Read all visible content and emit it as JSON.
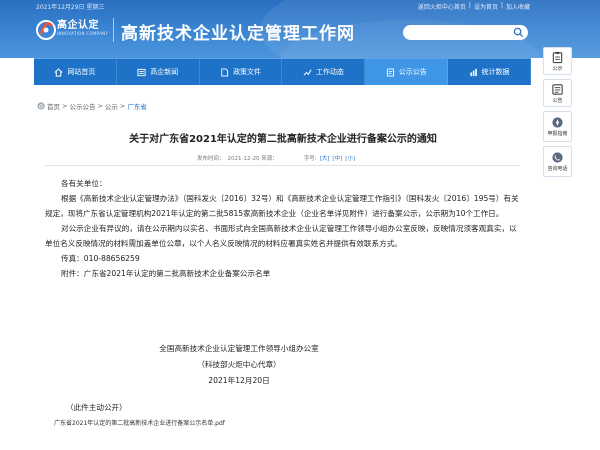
{
  "header": {
    "date": "2021年12月29日 星期三",
    "top_links": [
      "返回火炬中心首页",
      "|",
      "设为首页",
      "|",
      "加入收藏"
    ],
    "logo_text": "高企认定",
    "logo_sub": "INNOVATION COMPANY",
    "site_title": "高新技术企业认定管理工作网",
    "search_placeholder": ""
  },
  "nav": [
    {
      "label": "网站首页",
      "icon": "home-icon"
    },
    {
      "label": "高企新闻",
      "icon": "news-icon"
    },
    {
      "label": "政策文件",
      "icon": "document-icon"
    },
    {
      "label": "工作动态",
      "icon": "trend-icon"
    },
    {
      "label": "公示公告",
      "icon": "notice-icon",
      "active": true
    },
    {
      "label": "统计数据",
      "icon": "stats-icon"
    }
  ],
  "side": [
    {
      "label": "公示",
      "icon": "clipboard-icon"
    },
    {
      "label": "公告",
      "icon": "announcement-icon"
    },
    {
      "label": "申报指南",
      "icon": "guide-icon"
    },
    {
      "label": "咨询电话",
      "icon": "phone-icon"
    }
  ],
  "breadcrumb": {
    "items": [
      "首页",
      ">",
      "公示公告",
      ">",
      "公示",
      ">"
    ],
    "current": "广东省"
  },
  "article": {
    "title": "关于对广东省2021年认定的第二批高新技术企业进行备案公示的通知",
    "published_label": "发布时间：",
    "published_date": "2021-12-20 来源：",
    "font_label": "字号:",
    "font_sizes": [
      "[大]",
      "[中]",
      "[小]"
    ],
    "greeting": "各有关单位：",
    "para1": "根据《高新技术企业认定管理办法》（国科发火〔2016〕32号）和《高新技术企业认定管理工作指引》（国科发火〔2016〕195号）有关规定，现将广东省认定管理机构2021年认定的第二批5815家高新技术企业（企业名单详见附件）进行备案公示，公示期为10个工作日。",
    "para2": "对公示企业有异议的，请在公示期内以实名、书面形式向全国高新技术企业认定管理工作领导小组办公室反映，反映情况须客观真实，以单位名义反映情况的材料需加盖单位公章，以个人名义反映情况的材料应署真实姓名并提供有效联系方式。",
    "fax": "传真：010-88656259",
    "attachment": "附件：广东省2021年认定的第二批高新技术企业备案公示名单",
    "sig1": "全国高新技术企业认定管理工作领导小组办公室",
    "sig2": "（科技部火炬中心代章）",
    "sig3": "2021年12月20日",
    "note": "（此件主动公开）",
    "attach_link": "广东省2021年认定的第二批高新技术企业进行备案公示名单.pdf"
  }
}
